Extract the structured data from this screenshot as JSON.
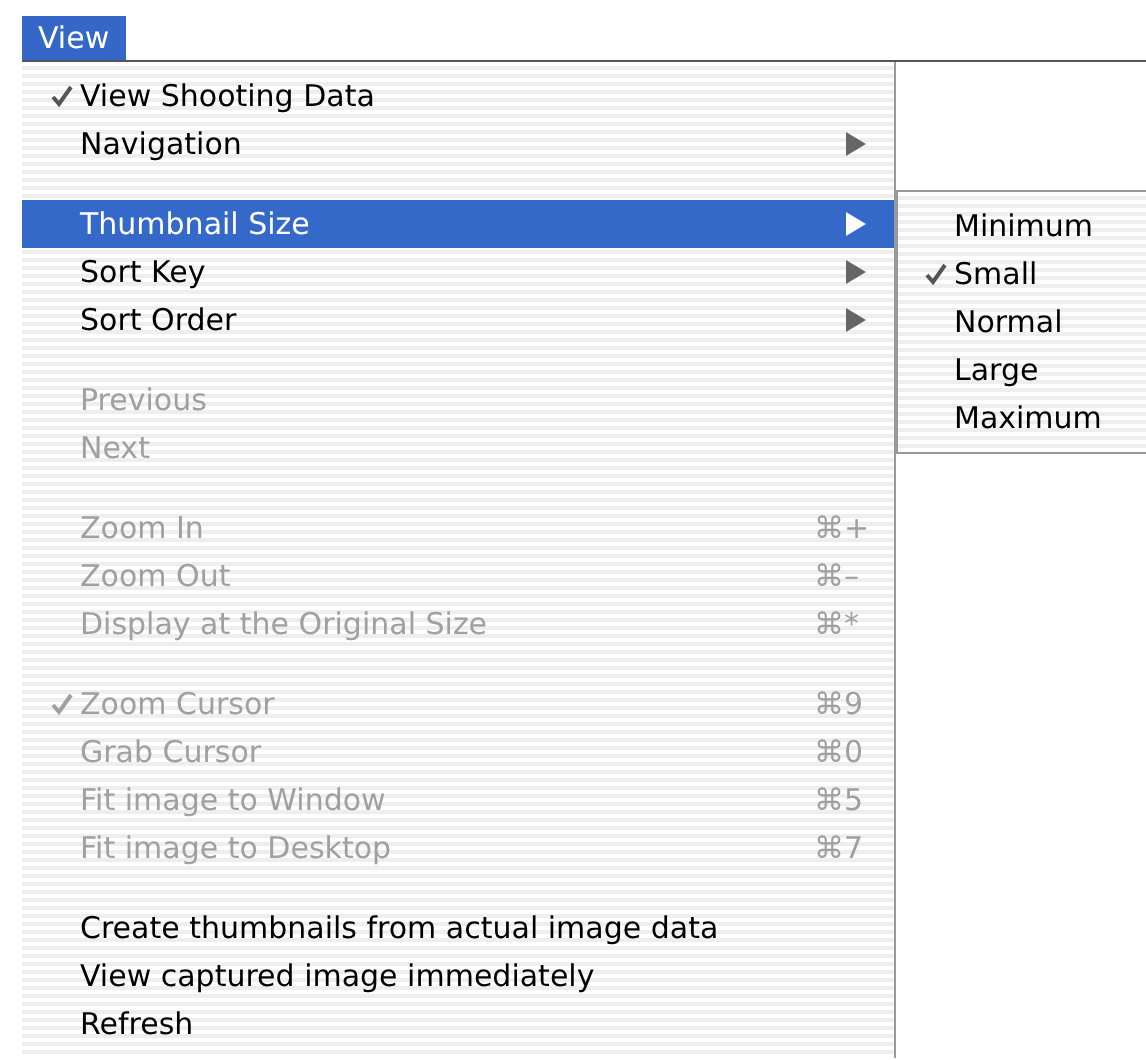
{
  "menu_title": {
    "label": "View",
    "selected": true
  },
  "items": [
    {
      "kind": "command",
      "label": "View Shooting Data",
      "checked": true,
      "disabled": false,
      "selected": false
    },
    {
      "kind": "submenu",
      "label": "Navigation",
      "checked": false,
      "disabled": false,
      "selected": false
    },
    {
      "kind": "separator"
    },
    {
      "kind": "submenu",
      "label": "Thumbnail Size",
      "checked": false,
      "disabled": false,
      "selected": true,
      "children": [
        {
          "label": "Minimum",
          "checked": false
        },
        {
          "label": "Small",
          "checked": true
        },
        {
          "label": "Normal",
          "checked": false
        },
        {
          "label": "Large",
          "checked": false
        },
        {
          "label": "Maximum",
          "checked": false
        }
      ]
    },
    {
      "kind": "submenu",
      "label": "Sort Key",
      "checked": false,
      "disabled": false,
      "selected": false
    },
    {
      "kind": "submenu",
      "label": "Sort Order",
      "checked": false,
      "disabled": false,
      "selected": false
    },
    {
      "kind": "separator"
    },
    {
      "kind": "command",
      "label": "Previous",
      "checked": false,
      "disabled": true,
      "selected": false
    },
    {
      "kind": "command",
      "label": "Next",
      "checked": false,
      "disabled": true,
      "selected": false
    },
    {
      "kind": "separator"
    },
    {
      "kind": "command",
      "label": "Zoom In",
      "shortcut": "⌘+",
      "checked": false,
      "disabled": true,
      "selected": false
    },
    {
      "kind": "command",
      "label": "Zoom Out",
      "shortcut": "⌘–",
      "checked": false,
      "disabled": true,
      "selected": false
    },
    {
      "kind": "command",
      "label": "Display at the Original Size",
      "shortcut": "⌘*",
      "checked": false,
      "disabled": true,
      "selected": false
    },
    {
      "kind": "separator"
    },
    {
      "kind": "command",
      "label": "Zoom Cursor",
      "shortcut": "⌘9",
      "checked": true,
      "disabled": true,
      "selected": false
    },
    {
      "kind": "command",
      "label": "Grab Cursor",
      "shortcut": "⌘0",
      "checked": false,
      "disabled": true,
      "selected": false
    },
    {
      "kind": "command",
      "label": "Fit image to Window",
      "shortcut": "⌘5",
      "checked": false,
      "disabled": true,
      "selected": false
    },
    {
      "kind": "command",
      "label": "Fit image to Desktop",
      "shortcut": "⌘7",
      "checked": false,
      "disabled": true,
      "selected": false
    },
    {
      "kind": "separator"
    },
    {
      "kind": "command",
      "label": "Create thumbnails from actual image data",
      "checked": false,
      "disabled": false,
      "selected": false
    },
    {
      "kind": "command",
      "label": "View captured image immediately",
      "checked": false,
      "disabled": false,
      "selected": false
    },
    {
      "kind": "command",
      "label": "Refresh",
      "checked": false,
      "disabled": false,
      "selected": false
    }
  ]
}
